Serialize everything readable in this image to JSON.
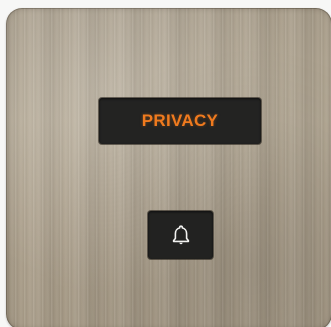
{
  "panel": {
    "indicator_label": "PRIVACY",
    "indicator_color": "#f07a1e",
    "button_icon": "bell-icon",
    "plate_finish_color": "#ada18d"
  }
}
